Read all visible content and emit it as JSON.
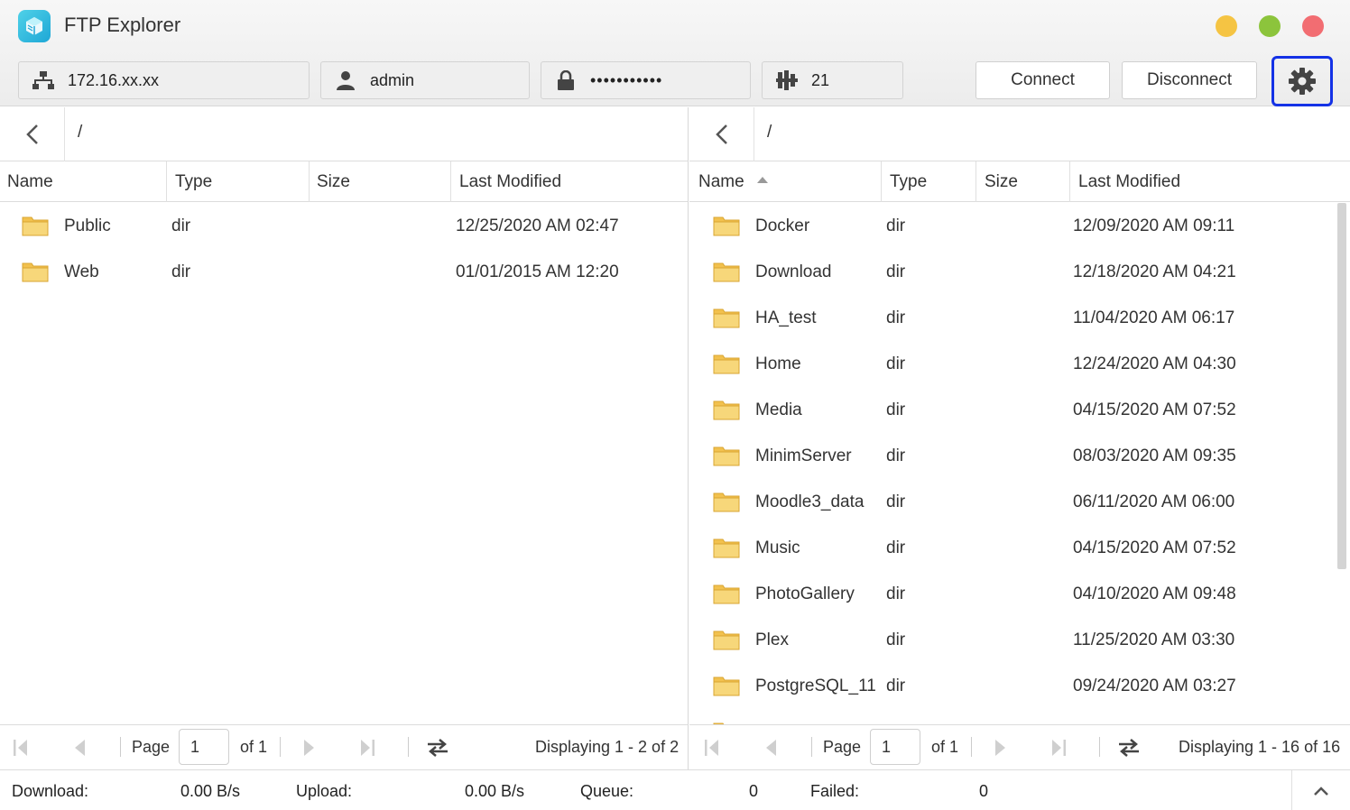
{
  "app": {
    "title": "FTP Explorer"
  },
  "window_controls": {
    "minimize_color": "#f5c443",
    "maximize_color": "#8cc43c",
    "close_color": "#f26d72"
  },
  "connection": {
    "host": "172.16.xx.xx",
    "username": "admin",
    "password": "•••••••••••",
    "port": "21",
    "connect_label": "Connect",
    "disconnect_label": "Disconnect",
    "settings_icon": "gear-icon",
    "accent": "#1432e6"
  },
  "left_pane": {
    "path": "/",
    "columns": [
      "Name",
      "Type",
      "Size",
      "Last Modified"
    ],
    "rows": [
      {
        "name": "Public",
        "type": "dir",
        "size": "",
        "modified": "12/25/2020 AM 02:47"
      },
      {
        "name": "Web",
        "type": "dir",
        "size": "",
        "modified": "01/01/2015 AM 12:20"
      }
    ],
    "pager": {
      "page_label": "Page",
      "page": "1",
      "of_label": "of 1",
      "displaying": "Displaying 1 - 2 of 2"
    }
  },
  "right_pane": {
    "path": "/",
    "columns": [
      "Name",
      "Type",
      "Size",
      "Last Modified"
    ],
    "sort": "Name ascending",
    "rows": [
      {
        "name": "Docker",
        "type": "dir",
        "size": "",
        "modified": "12/09/2020 AM 09:11"
      },
      {
        "name": "Download",
        "type": "dir",
        "size": "",
        "modified": "12/18/2020 AM 04:21"
      },
      {
        "name": "HA_test",
        "type": "dir",
        "size": "",
        "modified": "11/04/2020 AM 06:17"
      },
      {
        "name": "Home",
        "type": "dir",
        "size": "",
        "modified": "12/24/2020 AM 04:30"
      },
      {
        "name": "Media",
        "type": "dir",
        "size": "",
        "modified": "04/15/2020 AM 07:52"
      },
      {
        "name": "MinimServer",
        "type": "dir",
        "size": "",
        "modified": "08/03/2020 AM 09:35"
      },
      {
        "name": "Moodle3_data",
        "type": "dir",
        "size": "",
        "modified": "06/11/2020 AM 06:00"
      },
      {
        "name": "Music",
        "type": "dir",
        "size": "",
        "modified": "04/15/2020 AM 07:52"
      },
      {
        "name": "PhotoGallery",
        "type": "dir",
        "size": "",
        "modified": "04/10/2020 AM 09:48"
      },
      {
        "name": "Plex",
        "type": "dir",
        "size": "",
        "modified": "11/25/2020 AM 03:30"
      },
      {
        "name": "PostgreSQL_11",
        "type": "dir",
        "size": "",
        "modified": "09/24/2020 AM 03:27"
      },
      {
        "name": "",
        "type": "",
        "size": "",
        "modified": ""
      }
    ],
    "pager": {
      "page_label": "Page",
      "page": "1",
      "of_label": "of 1",
      "displaying": "Displaying 1 - 16 of 16"
    }
  },
  "status": {
    "download_label": "Download:",
    "download_value": "0.00 B/s",
    "upload_label": "Upload:",
    "upload_value": "0.00 B/s",
    "queue_label": "Queue:",
    "queue_value": "0",
    "failed_label": "Failed:",
    "failed_value": "0"
  },
  "folder_color": "#f2c14e"
}
